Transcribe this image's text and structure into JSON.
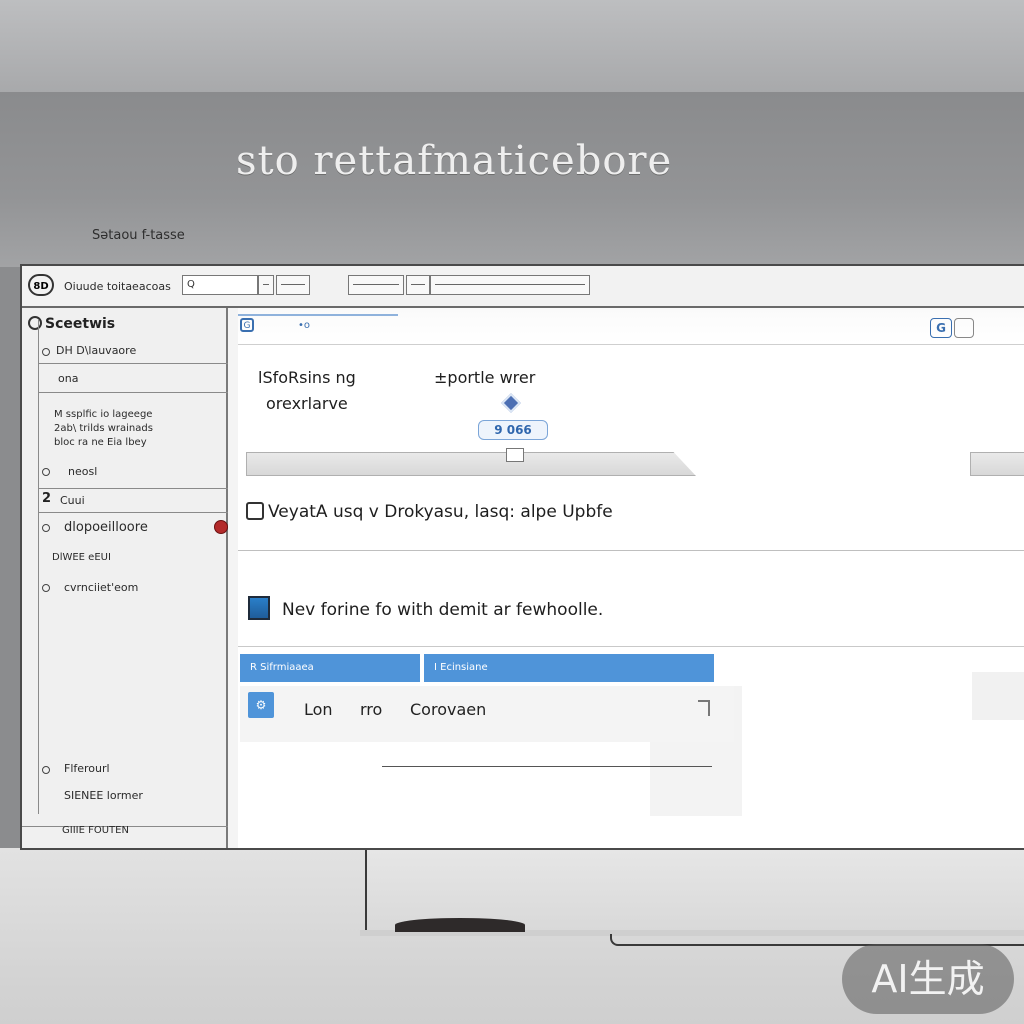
{
  "scene": {
    "headline": "sto rettafmaticebore",
    "subline": "Sətaou  f-tasse",
    "watermark": "AI生成"
  },
  "toolbar": {
    "logo": "8D",
    "app_title": "Oiuude toitaeacoas",
    "search_value": "Q"
  },
  "sidebar": {
    "header": "Sceetwis",
    "items": [
      {
        "label": "DH D\\lauvaore"
      },
      {
        "label": "ona"
      },
      {
        "label": "M ssplfic io lageege\n2ab\\ trilds wrainads\nbloc ra ne Eia lbey"
      },
      {
        "label": "neosl"
      },
      {
        "label": "Cuui"
      },
      {
        "label": "dlopoeilloore"
      },
      {
        "label": "DlWEE eEUI"
      },
      {
        "label": "cvrnciiet'eom"
      },
      {
        "label": "Flferourl"
      },
      {
        "label": "SIENEE lormer"
      },
      {
        "label": "GIIIE FOUTEN"
      }
    ],
    "number_badge": "2"
  },
  "content": {
    "top_icon": "G",
    "top_link": "•o",
    "search_icon": "G",
    "heading_left": "lSfoRsins ng",
    "heading_left_2": "orexrlarve",
    "heading_right": "±portle  wrer",
    "chip": "9 066",
    "row_1": "VeyatA  usq v  Drokyasu, lasq: alpe  Upbfe",
    "row_2": "Nev forine fo with demit ar fewhoolle.",
    "tab_1": "R  Sifrmiaaea",
    "tab_2": "I  Ecinsiane",
    "result": {
      "col_1": "Lon",
      "col_2": "rro",
      "col_3": "Corovaen"
    }
  }
}
